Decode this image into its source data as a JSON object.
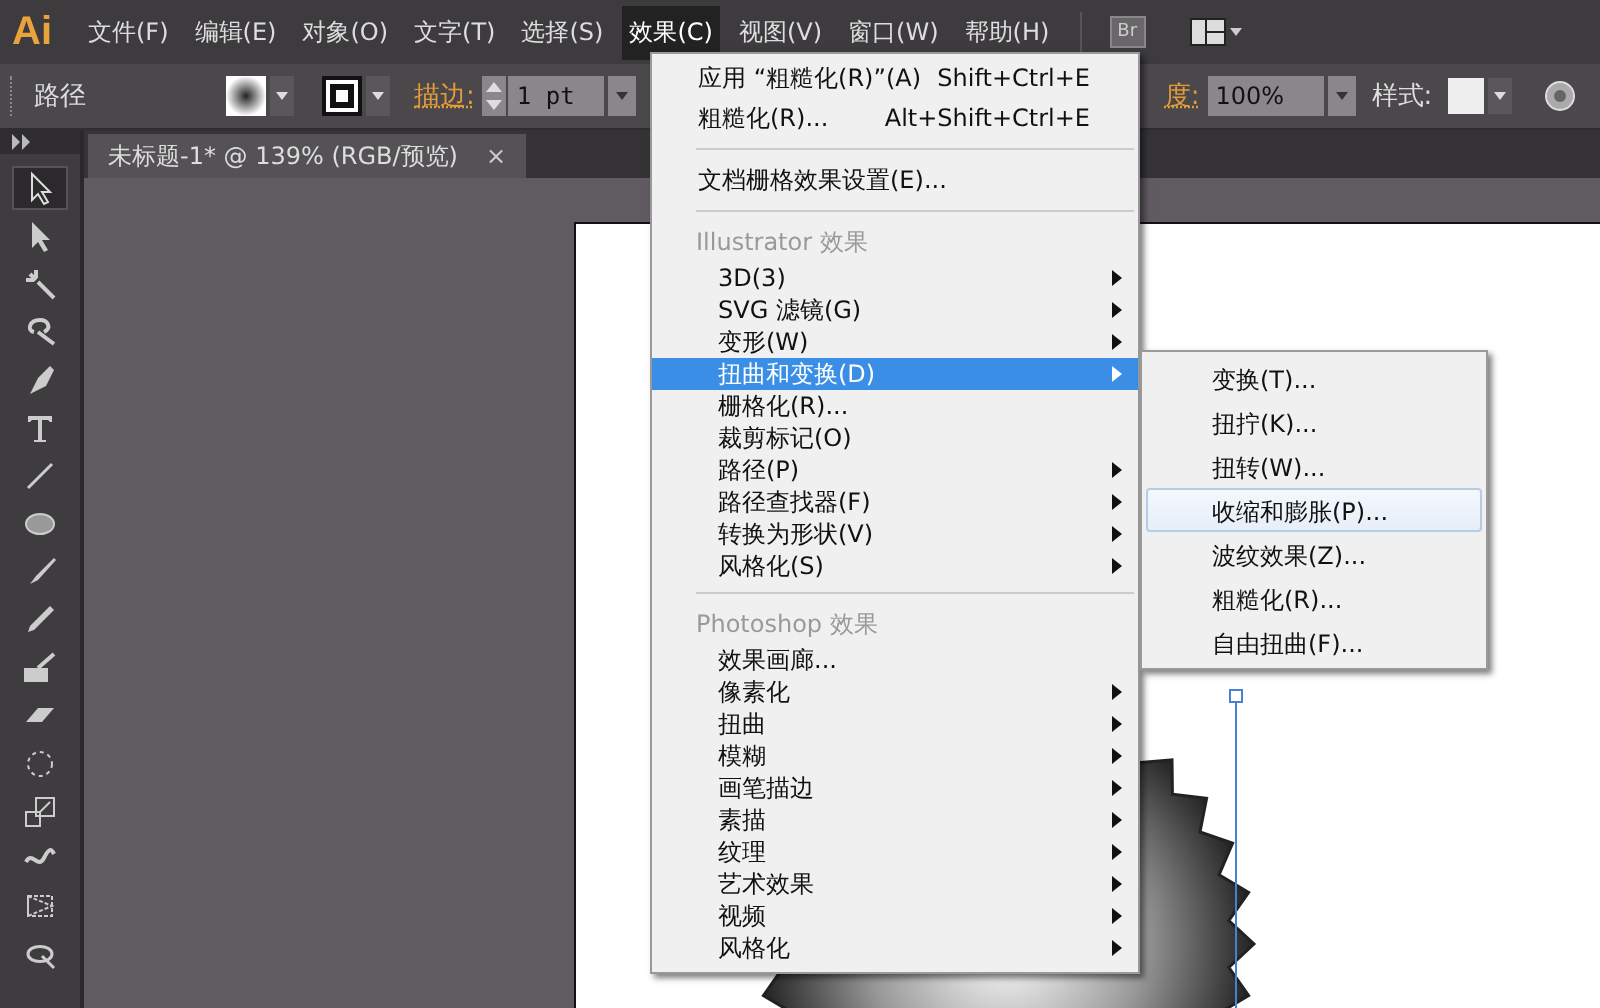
{
  "app": {
    "logo": "Ai"
  },
  "menu_bar": [
    {
      "label": "文件(F)",
      "selected": false
    },
    {
      "label": "编辑(E)",
      "selected": false
    },
    {
      "label": "对象(O)",
      "selected": false
    },
    {
      "label": "文字(T)",
      "selected": false
    },
    {
      "label": "选择(S)",
      "selected": false
    },
    {
      "label": "效果(C)",
      "selected": true
    },
    {
      "label": "视图(V)",
      "selected": false
    },
    {
      "label": "窗口(W)",
      "selected": false
    },
    {
      "label": "帮助(H)",
      "selected": false
    }
  ],
  "bridge_button": "Br",
  "control_bar": {
    "object_type": "路径",
    "stroke_label": "描边:",
    "stroke_weight": "1 pt",
    "opacity_label": "度:",
    "opacity": "100%",
    "style_label": "样式:"
  },
  "document_tab": {
    "title": "未标题-1* @ 139% (RGB/预览)",
    "close": "×"
  },
  "tools": [
    {
      "selected": true
    },
    {
      "selected": false
    },
    {
      "selected": false
    },
    {
      "selected": false
    },
    {
      "selected": false
    },
    {
      "selected": false
    },
    {
      "selected": false
    },
    {
      "selected": false
    },
    {
      "selected": false
    },
    {
      "selected": false
    },
    {
      "selected": false
    },
    {
      "selected": false
    },
    {
      "selected": false
    },
    {
      "selected": false
    },
    {
      "selected": false
    },
    {
      "selected": false
    },
    {
      "selected": false
    }
  ],
  "effect_menu": [
    {
      "kind": "command",
      "label": "应用 “粗糙化(R)”(A)",
      "shortcut": "Shift+Ctrl+E",
      "selected": false,
      "submenu": false
    },
    {
      "kind": "command",
      "label": "粗糙化(R)...",
      "shortcut": "Alt+Shift+Ctrl+E",
      "selected": false,
      "submenu": false
    },
    {
      "kind": "separator"
    },
    {
      "kind": "command",
      "label": "文档栅格效果设置(E)...",
      "selected": false,
      "submenu": false
    },
    {
      "kind": "separator"
    },
    {
      "kind": "header",
      "label": "Illustrator 效果"
    },
    {
      "kind": "effect",
      "label": "3D(3)",
      "selected": false,
      "submenu": true
    },
    {
      "kind": "effect",
      "label": "SVG 滤镜(G)",
      "selected": false,
      "submenu": true
    },
    {
      "kind": "effect",
      "label": "变形(W)",
      "selected": false,
      "submenu": true
    },
    {
      "kind": "effect",
      "label": "扭曲和变换(D)",
      "selected": true,
      "submenu": true
    },
    {
      "kind": "effect",
      "label": "栅格化(R)...",
      "selected": false,
      "submenu": false
    },
    {
      "kind": "effect",
      "label": "裁剪标记(O)",
      "selected": false,
      "submenu": false
    },
    {
      "kind": "effect",
      "label": "路径(P)",
      "selected": false,
      "submenu": true
    },
    {
      "kind": "effect",
      "label": "路径查找器(F)",
      "selected": false,
      "submenu": true
    },
    {
      "kind": "effect",
      "label": "转换为形状(V)",
      "selected": false,
      "submenu": true
    },
    {
      "kind": "effect",
      "label": "风格化(S)",
      "selected": false,
      "submenu": true
    },
    {
      "kind": "separator"
    },
    {
      "kind": "header",
      "label": "Photoshop 效果"
    },
    {
      "kind": "effect",
      "label": "效果画廊...",
      "selected": false,
      "submenu": false
    },
    {
      "kind": "effect",
      "label": "像素化",
      "selected": false,
      "submenu": true
    },
    {
      "kind": "effect",
      "label": "扭曲",
      "selected": false,
      "submenu": true
    },
    {
      "kind": "effect",
      "label": "模糊",
      "selected": false,
      "submenu": true
    },
    {
      "kind": "effect",
      "label": "画笔描边",
      "selected": false,
      "submenu": true
    },
    {
      "kind": "effect",
      "label": "素描",
      "selected": false,
      "submenu": true
    },
    {
      "kind": "effect",
      "label": "纹理",
      "selected": false,
      "submenu": true
    },
    {
      "kind": "effect",
      "label": "艺术效果",
      "selected": false,
      "submenu": true
    },
    {
      "kind": "effect",
      "label": "视频",
      "selected": false,
      "submenu": true
    },
    {
      "kind": "effect",
      "label": "风格化",
      "selected": false,
      "submenu": true
    }
  ],
  "distort_submenu": [
    {
      "label": "变换(T)...",
      "selected": false
    },
    {
      "label": "扭拧(K)...",
      "selected": false
    },
    {
      "label": "扭转(W)...",
      "selected": false
    },
    {
      "label": "收缩和膨胀(P)...",
      "selected": true
    },
    {
      "label": "波纹效果(Z)...",
      "selected": false
    },
    {
      "label": "粗糙化(R)...",
      "selected": false
    },
    {
      "label": "自由扭曲(F)...",
      "selected": false
    }
  ]
}
